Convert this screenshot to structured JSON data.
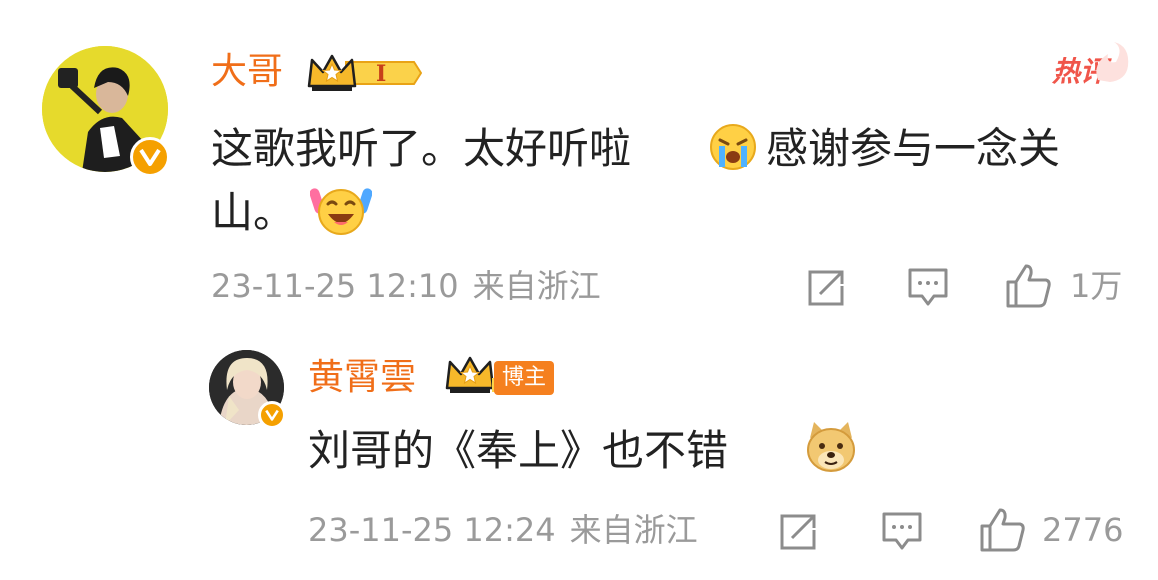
{
  "comment": {
    "author": "大哥",
    "level_badge": "I",
    "hot_label": "热评",
    "text_line1": "这歌我听了。太好听啦",
    "text_after_emoji1": "感谢参与一念关",
    "text_line2": "山。",
    "emoji1": "crying-face-icon",
    "emoji2": "laughing-cheering-face-icon",
    "timestamp": "23-11-25 12:10",
    "location": "来自浙江",
    "like_count": "1万"
  },
  "reply": {
    "author": "黄霄雲",
    "host_tag": "博主",
    "text": "刘哥的《奉上》也不错",
    "emoji": "doge-face-icon",
    "timestamp": "23-11-25 12:24",
    "location": "来自浙江",
    "like_count": "2776"
  },
  "colors": {
    "name": "#f06e19",
    "meta": "#9a9a9a",
    "hot": "#f0554a",
    "verified_badge": "#f5a000",
    "host_tag": "#f5801f"
  }
}
